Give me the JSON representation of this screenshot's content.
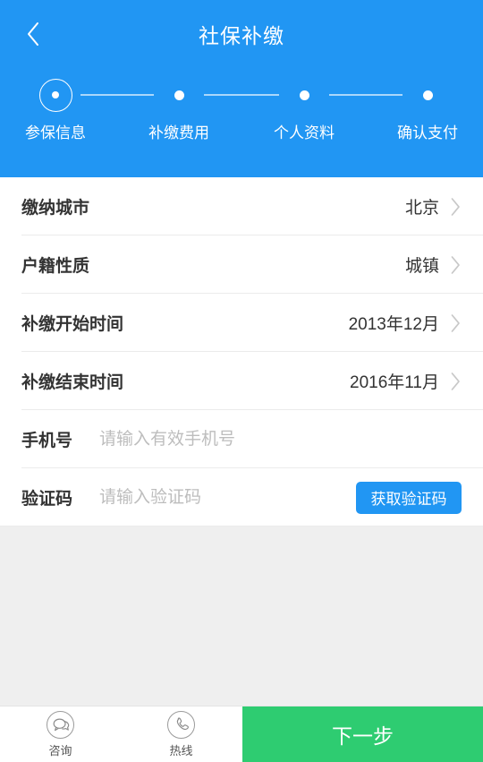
{
  "theme": {
    "header_blue": "#2196f3",
    "accent_blue": "#2196f3",
    "next_green": "#2ecc71",
    "page_gray": "#efefef",
    "card_white": "#ffffff",
    "placeholder_gray": "#bdbdbd"
  },
  "header": {
    "back_icon": "chevron-left-icon",
    "title": "社保补缴"
  },
  "stepper": {
    "active_index": 0,
    "steps": [
      {
        "label": "参保信息",
        "state": "active"
      },
      {
        "label": "补缴费用",
        "state": "inactive"
      },
      {
        "label": "个人资料",
        "state": "inactive"
      },
      {
        "label": "确认支付",
        "state": "inactive"
      }
    ]
  },
  "form": {
    "rows": [
      {
        "label": "缴纳城市",
        "value": "北京",
        "type": "select",
        "chevron": "chevron-right-icon"
      },
      {
        "label": "户籍性质",
        "value": "城镇",
        "type": "select",
        "chevron": "chevron-right-icon"
      },
      {
        "label": "补缴开始时间",
        "value": "2013年12月",
        "type": "select",
        "chevron": "chevron-right-icon"
      },
      {
        "label": "补缴结束时间",
        "value": "2016年11月",
        "type": "select",
        "chevron": "chevron-right-icon"
      },
      {
        "label": "手机号",
        "value": "",
        "placeholder": "请输入有效手机号",
        "type": "input"
      },
      {
        "label": "验证码",
        "value": "",
        "placeholder": "请输入验证码",
        "type": "input-button",
        "button_label": "获取验证码"
      }
    ]
  },
  "bottom_bar": {
    "actions": [
      {
        "label": "咨询",
        "icon": "chat-bubbles-icon"
      },
      {
        "label": "热线",
        "icon": "phone-icon"
      }
    ],
    "next_label": "下一步"
  }
}
